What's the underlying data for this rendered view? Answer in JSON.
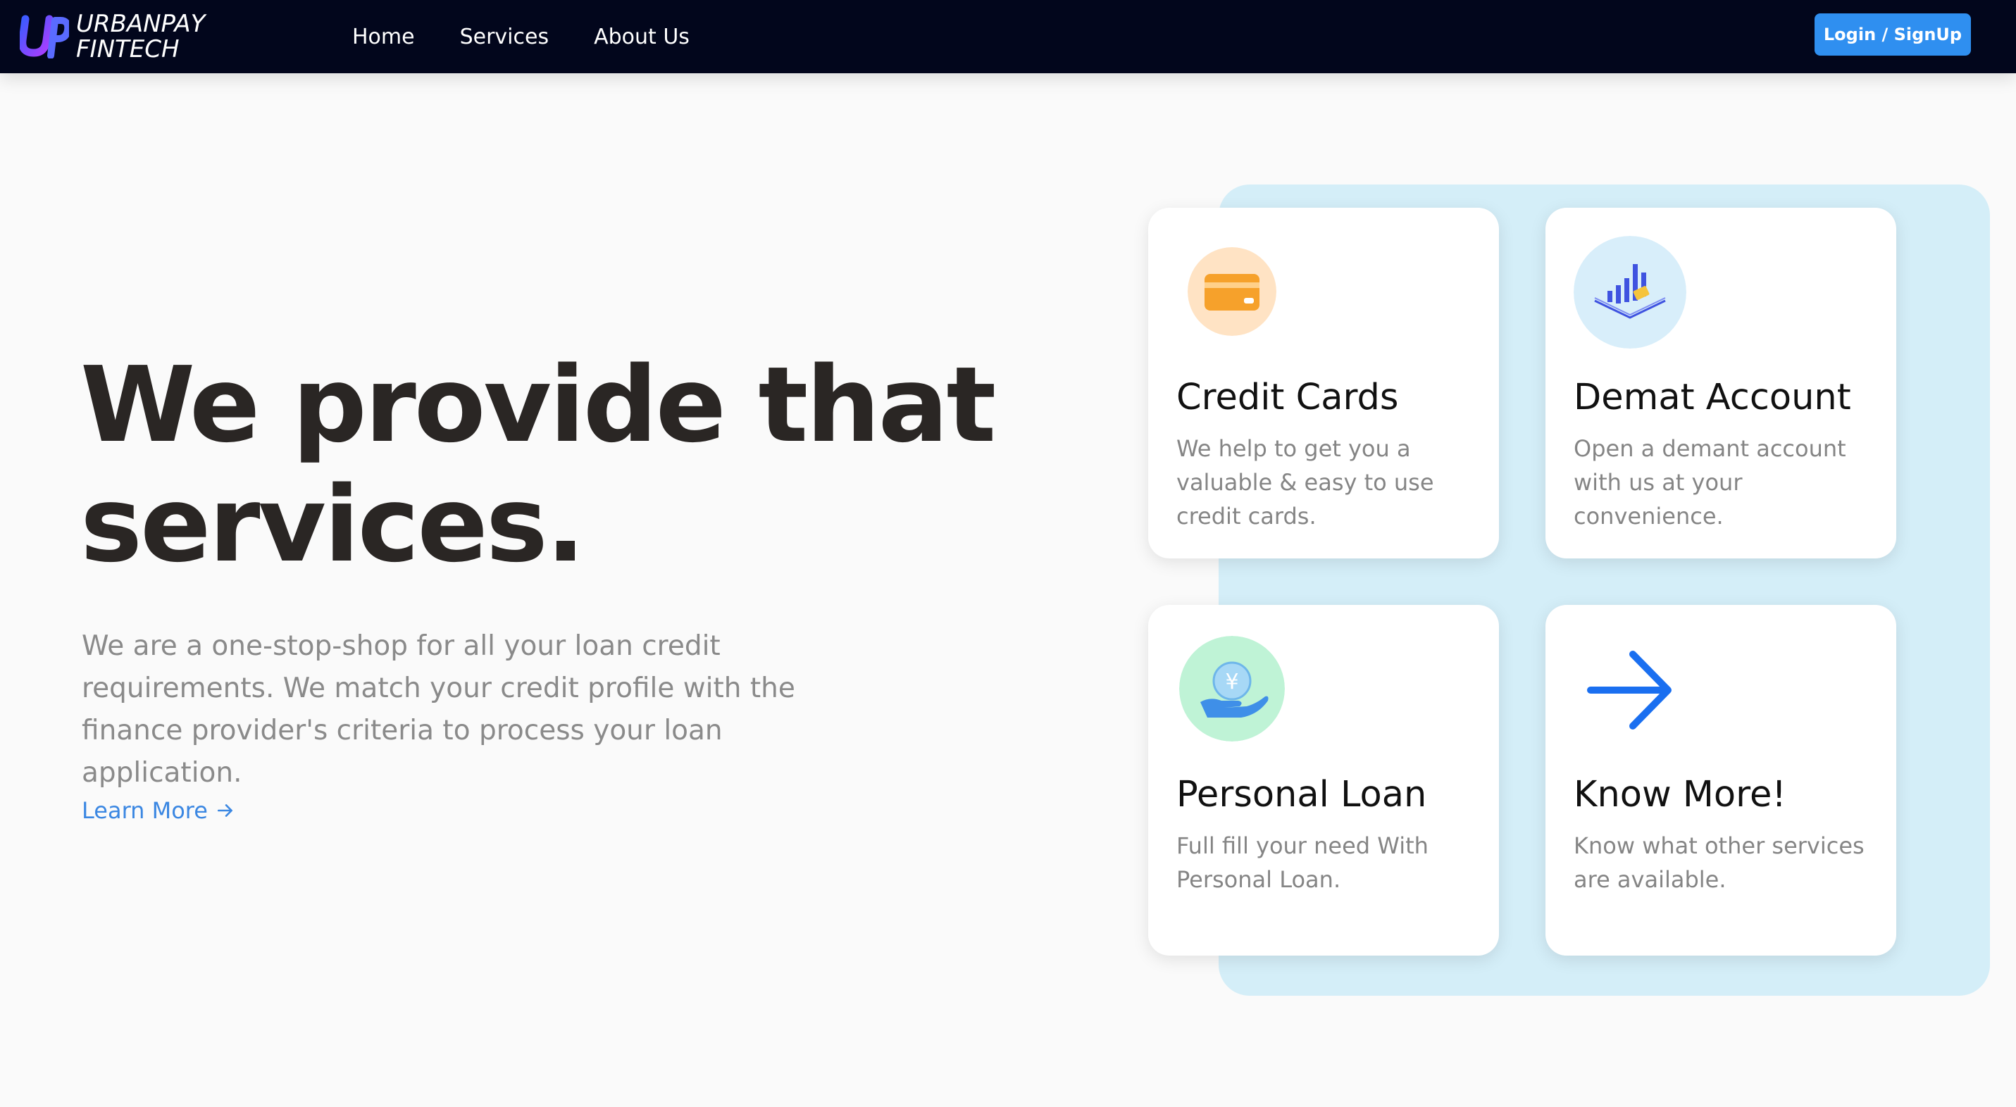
{
  "colors": {
    "navbar_bg": "#02061c",
    "primary_button": "#2f8ff0",
    "link": "#3b87e2",
    "cards_backdrop": "#d4eef8",
    "headline": "#2a2624",
    "body_text": "#8a8a8a"
  },
  "brand": {
    "line1": "URBANPAY",
    "line2": "FINTECH",
    "icon": "up-logo-icon"
  },
  "nav": {
    "items": [
      "Home",
      "Services",
      "About Us"
    ],
    "login_label": "Login / SignUp"
  },
  "hero": {
    "title": "We provide that services.",
    "description": "We are a one-stop-shop for all your loan credit requirements. We match your credit profile with the finance provider's criteria to process your loan application.",
    "link_label": "Learn More",
    "link_icon": "arrow-right-icon"
  },
  "cards": [
    {
      "title": "Credit Cards",
      "description": "We help to get you a valuable & easy to use credit cards.",
      "icon": "credit-card-icon"
    },
    {
      "title": "Demat Account",
      "description": "Open a demant account with us at your convenience.",
      "icon": "bar-chart-icon"
    },
    {
      "title": "Personal Loan",
      "description": "Full fill your need With Personal Loan.",
      "icon": "yen-coin-hand-icon"
    },
    {
      "title": "Know More!",
      "description": "Know what other services are available.",
      "icon": "arrow-right-icon"
    }
  ]
}
